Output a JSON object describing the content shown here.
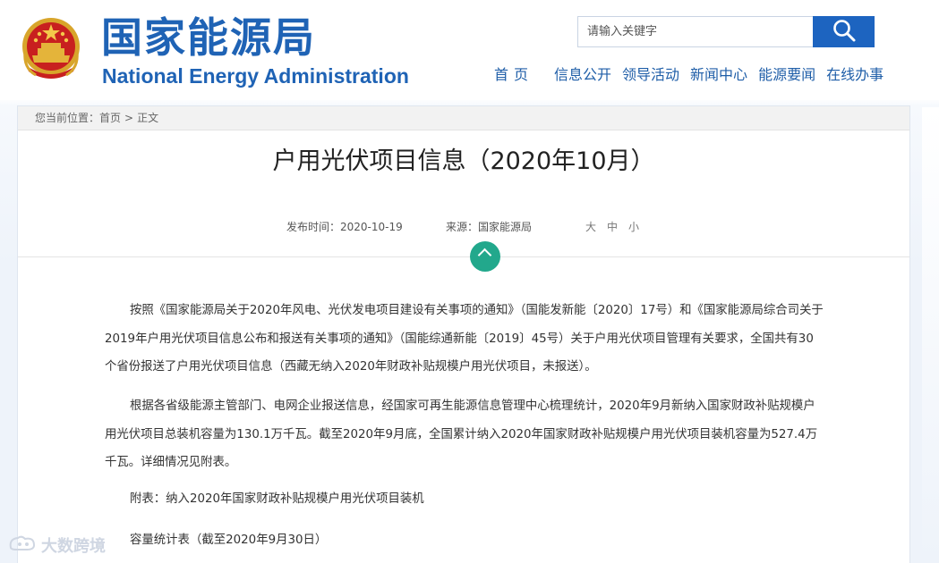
{
  "header": {
    "title_cn": "国家能源局",
    "title_en": "National Energy Administration",
    "emblem_icon": "national-emblem-icon"
  },
  "search": {
    "placeholder": "请输入关键字",
    "button_icon": "search-icon"
  },
  "nav": {
    "items": [
      "首页",
      "信息公开",
      "领导活动",
      "新闻中心",
      "能源要闻",
      "在线办事"
    ]
  },
  "breadcrumb": {
    "prefix": "您当前位置：",
    "home": "首页",
    "separator": ">",
    "current": "正文"
  },
  "article": {
    "title": "户用光伏项目信息（2020年10月）",
    "publish_label": "发布时间：",
    "publish_date": "2020-10-19",
    "source_label": "来源：",
    "source": "国家能源局",
    "font_sizes": [
      "大",
      "中",
      "小"
    ],
    "paragraphs": [
      "按照《国家能源局关于2020年风电、光伏发电项目建设有关事项的通知》（国能发新能〔2020〕17号）和《国家能源局综合司关于2019年户用光伏项目信息公布和报送有关事项的通知》（国能综通新能〔2019〕45号）关于户用光伏项目管理有关要求，全国共有30个省份报送了户用光伏项目信息（西藏无纳入2020年财政补贴规模户用光伏项目，未报送）。",
      "根据各省级能源主管部门、电网企业报送信息，经国家可再生能源信息管理中心梳理统计，2020年9月新纳入国家财政补贴规模户用光伏项目总装机容量为130.1万千瓦。截至2020年9月底，全国累计纳入2020年国家财政补贴规模户用光伏项目装机容量为527.4万千瓦。详细情况见附表。",
      "附表：纳入2020年国家财政补贴规模户用光伏项目装机",
      "容量统计表（截至2020年9月30日）"
    ]
  },
  "watermark": {
    "text": "大数跨境"
  },
  "colors": {
    "brand_blue": "#1f63b5",
    "button_blue": "#1d64c0",
    "toggle_green": "#22a88c"
  }
}
